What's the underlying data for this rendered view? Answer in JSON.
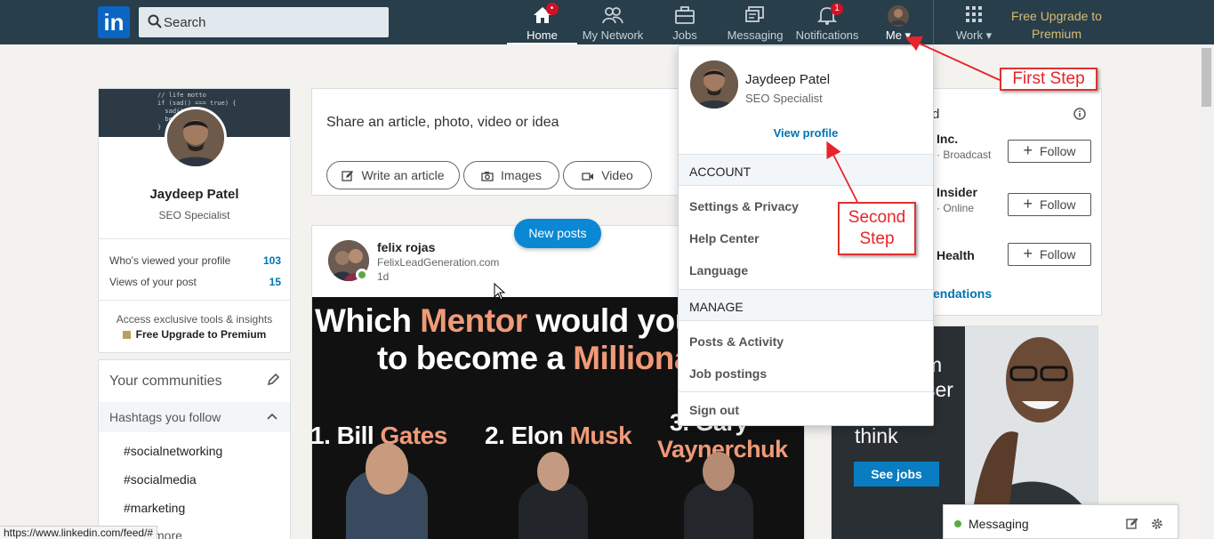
{
  "nav": {
    "logo_text": "in",
    "search_placeholder": "Search",
    "items": [
      {
        "label": "Home",
        "badge": "•"
      },
      {
        "label": "My Network"
      },
      {
        "label": "Jobs"
      },
      {
        "label": "Messaging"
      },
      {
        "label": "Notifications",
        "badge": "1"
      },
      {
        "label": "Me ▾"
      },
      {
        "label": "Work ▾"
      }
    ],
    "premium_link": "Free Upgrade to Premium"
  },
  "profile_card": {
    "cover_code": "// life motto\nif (sad() === true) {\n  sad().\n  be\n}",
    "name": "Jaydeep Patel",
    "title": "SEO Specialist",
    "stats": [
      {
        "label": "Who's viewed your profile",
        "value": "103"
      },
      {
        "label": "Views of your post",
        "value": "15"
      }
    ],
    "promo_text": "Access exclusive tools & insights",
    "promo_link": "Free Upgrade to Premium"
  },
  "communities": {
    "title": "Your communities",
    "hashtags_header": "Hashtags you follow",
    "hashtags": [
      "#socialnetworking",
      "#socialmedia",
      "#marketing"
    ],
    "show_more": "more"
  },
  "share_box": {
    "prompt": "Share an article, photo, video or idea",
    "buttons": [
      "Write an article",
      "Images",
      "Video"
    ]
  },
  "new_posts_pill": "New posts",
  "post": {
    "author": "felix rojas",
    "subtitle": "FelixLeadGeneration.com",
    "time": "1d",
    "image_line1_a": "Which ",
    "image_line1_b": "Mentor",
    "image_line1_c": " would you",
    "image_line2_a": "to become a ",
    "image_line2_b": "Millionai",
    "ranks": [
      {
        "num": "1. Bill ",
        "name": "Gates"
      },
      {
        "num": "2. Elon ",
        "name": "Musk"
      },
      {
        "num": "3. Gary",
        "name": "Vaynerchuk"
      }
    ]
  },
  "right_rail": {
    "header_fragment": "d",
    "suggestions": [
      {
        "name": "Inc.",
        "sub": "· Broadcast",
        "button": "Follow"
      },
      {
        "name": "Insider",
        "sub": "· Online",
        "button": "Follow"
      },
      {
        "name": "Health",
        "sub": "",
        "button": "Follow"
      }
    ],
    "recommendations_link": "endations"
  },
  "ad": {
    "frag1": "m",
    "frag2": "ser",
    "text": "think",
    "button": "See jobs"
  },
  "me_dropdown": {
    "name": "Jaydeep Patel",
    "title": "SEO Specialist",
    "view_profile": "View profile",
    "account_header": "ACCOUNT",
    "account_items": [
      "Settings & Privacy",
      "Help Center",
      "Language"
    ],
    "manage_header": "MANAGE",
    "manage_items": [
      "Posts & Activity",
      "Job postings"
    ],
    "sign_out": "Sign out"
  },
  "annotations": {
    "first_step": "First Step",
    "second_step_l1": "Second",
    "second_step_l2": "Step"
  },
  "messaging_dock": {
    "label": "Messaging"
  },
  "status_bar_url": "https://www.linkedin.com/feed/#",
  "colors": {
    "nav_bg": "#283e4a",
    "linkedin_blue": "#0073b1",
    "premium_gold": "#d9bd73",
    "annotation_red": "#e8232a"
  }
}
